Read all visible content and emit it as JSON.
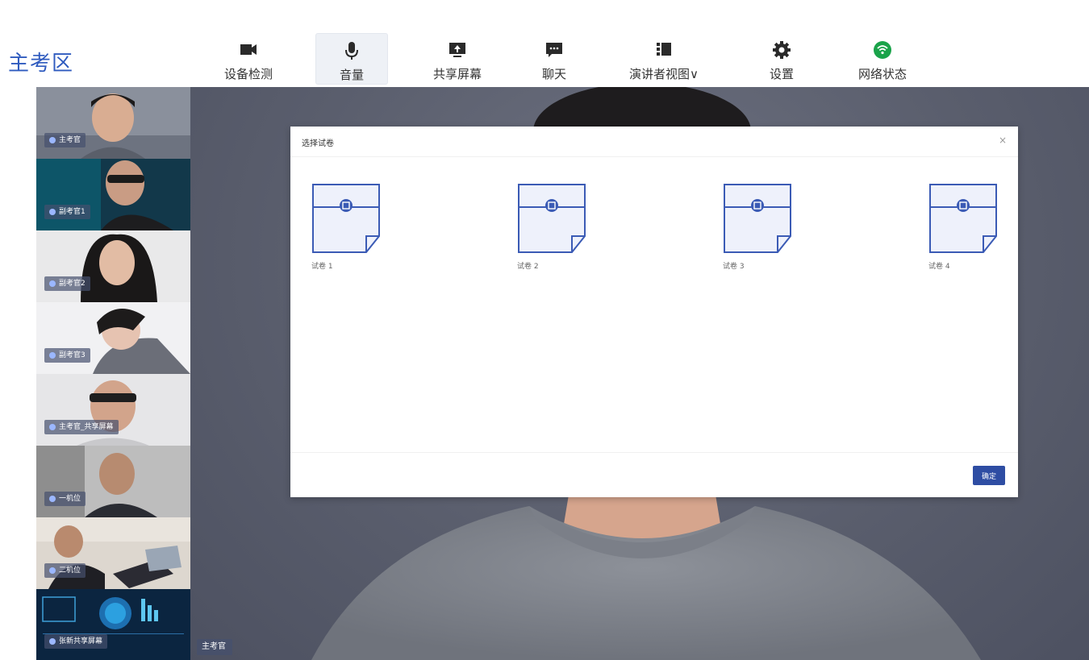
{
  "header": {
    "room_title": "主考区"
  },
  "toolbar": {
    "items": [
      {
        "label": "设备检测",
        "icon": "camera-icon",
        "active": false
      },
      {
        "label": "音量",
        "icon": "microphone-icon",
        "active": true
      },
      {
        "label": "共享屏幕",
        "icon": "share-screen-icon",
        "active": false
      },
      {
        "label": "聊天",
        "icon": "chat-icon",
        "active": false
      },
      {
        "label": "演讲者视图∨",
        "icon": "speaker-view-icon",
        "active": false
      },
      {
        "label": "设置",
        "icon": "gear-icon",
        "active": false
      },
      {
        "label": "网络状态",
        "icon": "wifi-icon",
        "active": false
      }
    ],
    "colors": {
      "icon": "#2a2a2a",
      "network_ok": "#1aa34a"
    }
  },
  "participants": [
    {
      "name": "主考官",
      "selected": true
    },
    {
      "name": "副考官1"
    },
    {
      "name": "副考官2"
    },
    {
      "name": "副考官3"
    },
    {
      "name": "主考官_共享屏幕"
    },
    {
      "name": "一机位"
    },
    {
      "name": "二机位"
    },
    {
      "name": "张新共享屏幕"
    }
  ],
  "stage": {
    "speaker_label": "主考官"
  },
  "modal": {
    "title": "选择试卷",
    "close_glyph": "×",
    "papers": [
      {
        "label": "试卷 1"
      },
      {
        "label": "试卷 2"
      },
      {
        "label": "试卷 3"
      },
      {
        "label": "试卷 4"
      }
    ],
    "confirm_label": "确定",
    "colors": {
      "paper_stroke": "#3b5bb5",
      "paper_fill": "#eef1fb",
      "button": "#2e4da3"
    }
  }
}
